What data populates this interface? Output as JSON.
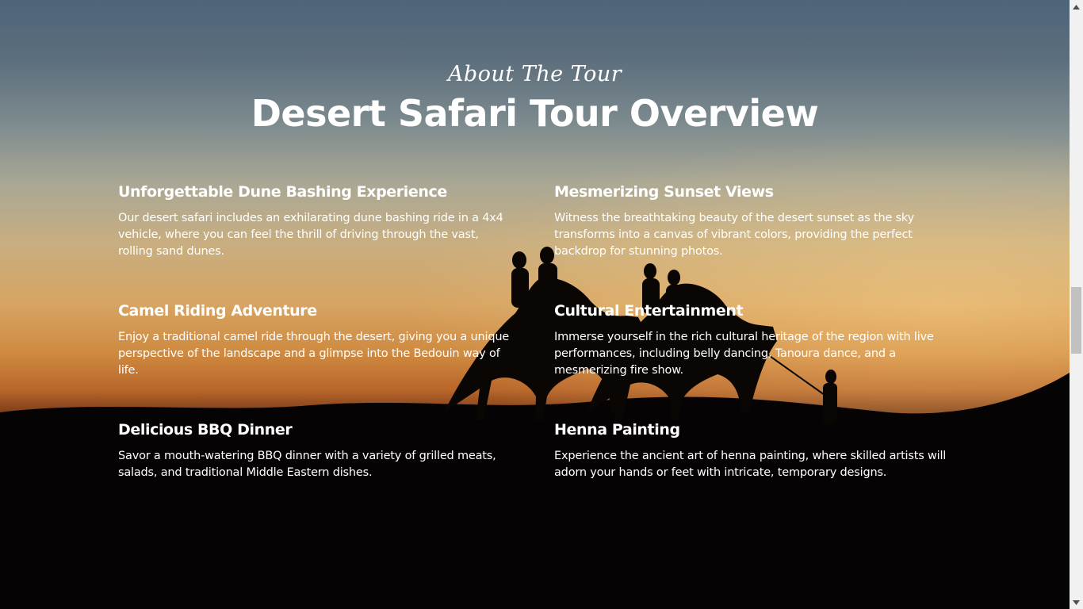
{
  "section": {
    "tagline": "About The Tour",
    "title": "Desert Safari Tour Overview"
  },
  "features": [
    {
      "title": "Unforgettable Dune Bashing Experience",
      "description": "Our desert safari includes an exhilarating dune bashing ride in a 4x4 vehicle, where you can feel the thrill of driving through the vast, rolling sand dunes."
    },
    {
      "title": "Mesmerizing Sunset Views",
      "description": "Witness the breathtaking beauty of the desert sunset as the sky transforms into a canvas of vibrant colors, providing the perfect backdrop for stunning photos."
    },
    {
      "title": "Camel Riding Adventure",
      "description": "Enjoy a traditional camel ride through the desert, giving you a unique perspective of the landscape and a glimpse into the Bedouin way of life."
    },
    {
      "title": "Cultural Entertainment",
      "description": "Immerse yourself in the rich cultural heritage of the region with live performances, including belly dancing, Tanoura dance, and a mesmerizing fire show."
    },
    {
      "title": "Delicious BBQ Dinner",
      "description": "Savor a mouth-watering BBQ dinner with a variety of grilled meats, salads, and traditional Middle Eastern dishes."
    },
    {
      "title": "Henna Painting",
      "description": "Experience the ancient art of henna painting, where skilled artists will adorn your hands or feet with intricate, temporary designs."
    }
  ],
  "scrollbar": {
    "up_icon": "triangle-up",
    "down_icon": "triangle-down"
  }
}
